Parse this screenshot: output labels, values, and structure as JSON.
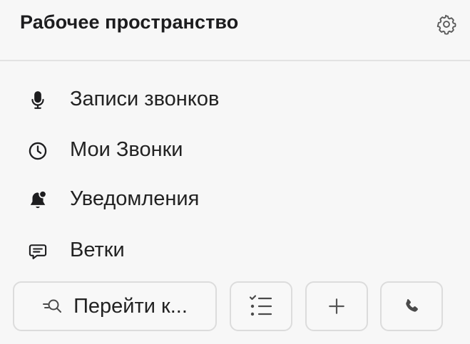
{
  "workspace": {
    "title": "Рабочее пространство",
    "settings_icon": "gear-icon"
  },
  "nav": {
    "items": [
      {
        "label": "Записи звонков",
        "icon": "microphone-icon"
      },
      {
        "label": "Мои Звонки",
        "icon": "clock-icon"
      },
      {
        "label": "Уведомления",
        "icon": "bell-badge-icon"
      },
      {
        "label": "Ветки",
        "icon": "chat-bubble-icon"
      }
    ]
  },
  "actions": {
    "goto_label": "Перейти к...",
    "goto_icon": "search-icon",
    "tasks_icon": "checklist-icon",
    "add_icon": "plus-icon",
    "call_icon": "phone-icon"
  }
}
